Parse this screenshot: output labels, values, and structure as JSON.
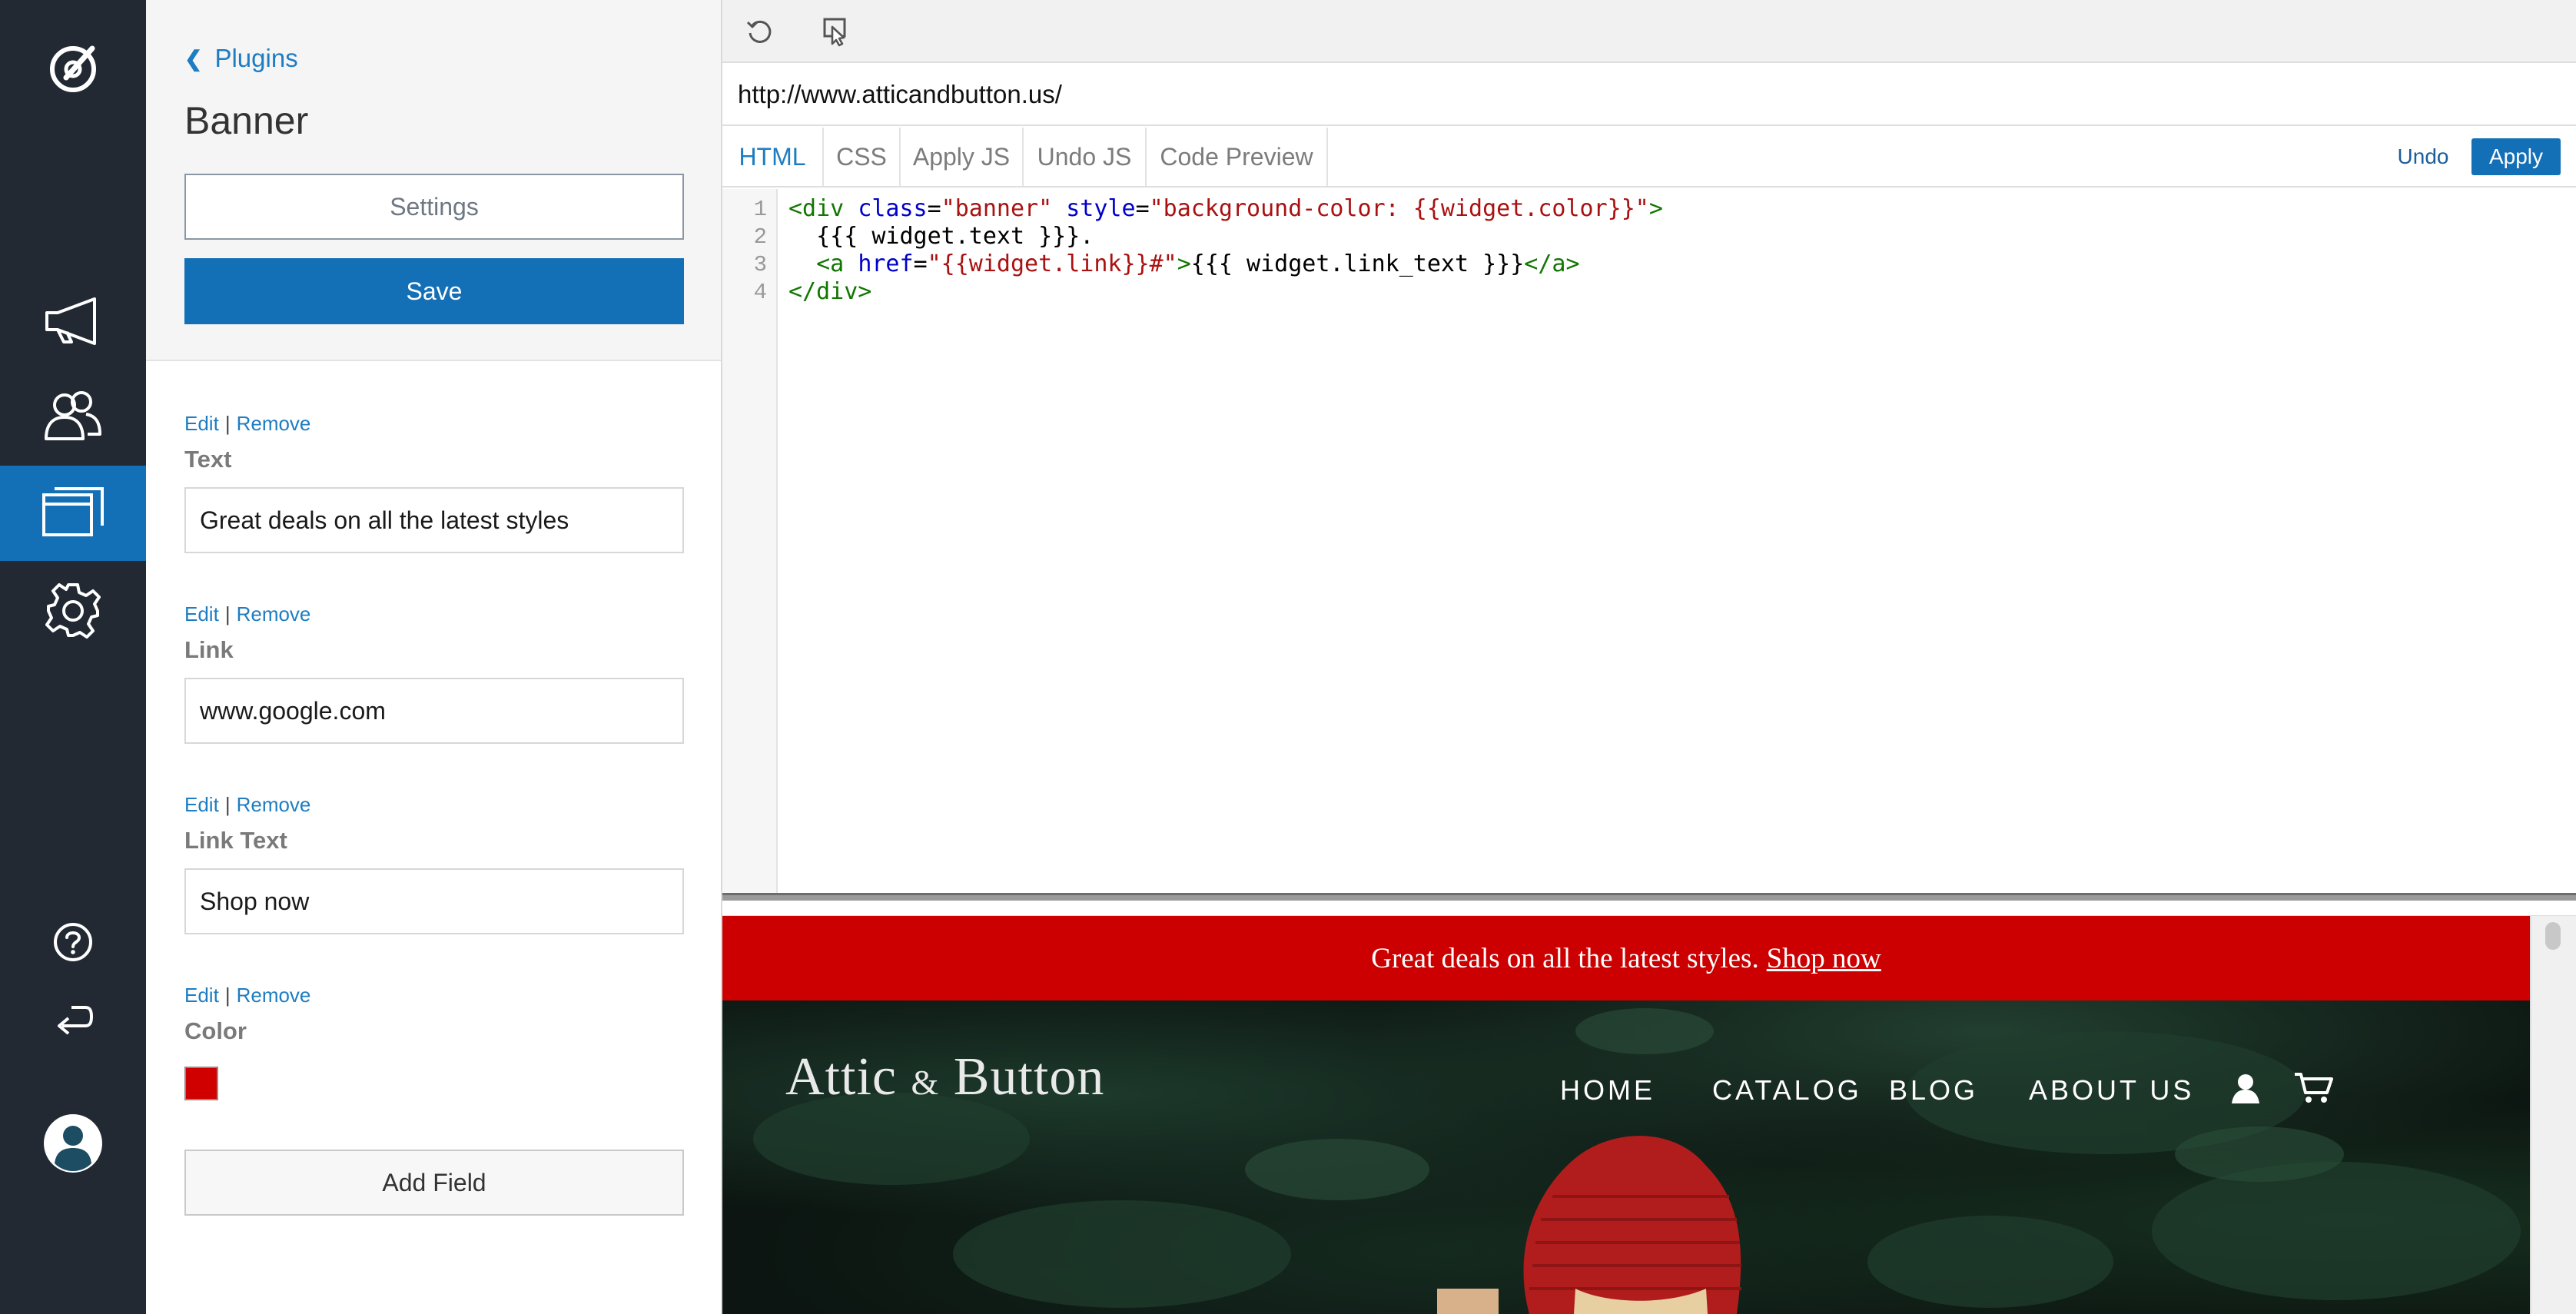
{
  "rail": {
    "items": [
      {
        "name": "logo",
        "icon": "compass-logo-icon"
      },
      {
        "name": "campaigns",
        "icon": "megaphone-icon"
      },
      {
        "name": "audiences",
        "icon": "users-icon"
      },
      {
        "name": "plugins",
        "icon": "windows-icon",
        "active": true
      },
      {
        "name": "settings",
        "icon": "gear-icon"
      },
      {
        "name": "help",
        "icon": "help-icon"
      },
      {
        "name": "return",
        "icon": "return-arrow-icon"
      },
      {
        "name": "account",
        "icon": "avatar-icon"
      }
    ],
    "active_color": "#1370b7",
    "bg_color": "#222933"
  },
  "panel": {
    "back_label": "Plugins",
    "title": "Banner",
    "settings_label": "Settings",
    "save_label": "Save",
    "edit_label": "Edit",
    "separator": "|",
    "remove_label": "Remove",
    "fields": [
      {
        "label": "Text",
        "value": "Great deals on all the latest styles"
      },
      {
        "label": "Link",
        "value": "www.google.com"
      },
      {
        "label": "Link Text",
        "value": "Shop now"
      },
      {
        "label": "Color",
        "value_color": "#d10000"
      }
    ],
    "add_field_label": "Add Field"
  },
  "editor": {
    "url": "http://www.atticandbutton.us/",
    "tabs": [
      "HTML",
      "CSS",
      "Apply JS",
      "Undo JS",
      "Code Preview"
    ],
    "active_tab": "HTML",
    "undo_label": "Undo",
    "apply_label": "Apply",
    "line_numbers": [
      "1",
      "2",
      "3",
      "4"
    ],
    "code": {
      "l1": {
        "t1": "<div ",
        "a1": "class",
        "e1": "=",
        "s1": "\"banner\"",
        "sp": " ",
        "a2": "style",
        "e2": "=",
        "s2": "\"background-color: {{widget.color}}\"",
        "t2": ">"
      },
      "l2": {
        "text": "  {{{ widget.text }}}."
      },
      "l3": {
        "ind": "  ",
        "t1": "<a ",
        "a1": "href",
        "e1": "=",
        "s1": "\"{{widget.link}}#\"",
        "t2": ">",
        "txt": "{{{ widget.link_text }}}",
        "t3": "</a>"
      },
      "l4": {
        "t1": "</div>"
      }
    }
  },
  "preview": {
    "banner_text": "Great deals on all the latest styles.",
    "banner_link": "Shop now",
    "banner_color": "#cc0000",
    "logo_part1": "Attic",
    "logo_amp": "&",
    "logo_part2": "Button",
    "nav": [
      "HOME",
      "CATALOG",
      "BLOG",
      "ABOUT US"
    ],
    "nav_icons": [
      "user-icon",
      "cart-icon"
    ]
  }
}
